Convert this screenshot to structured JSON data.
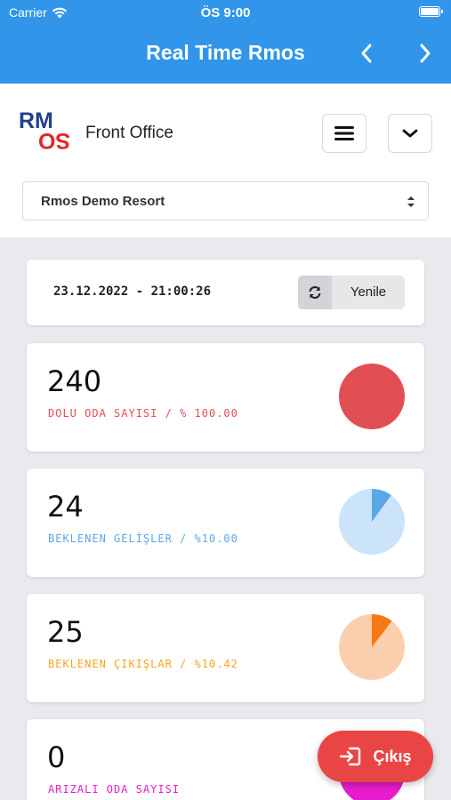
{
  "status_bar": {
    "carrier": "Carrier",
    "time": "ÖS 9:00",
    "wifi_icon": "wifi-icon",
    "battery_icon": "battery-icon"
  },
  "nav": {
    "title": "Real Time Rmos",
    "prev_icon": "chevron-left-icon",
    "next_icon": "chevron-right-icon"
  },
  "header": {
    "logo": "RMOS",
    "app_name": "Front Office",
    "menu_icon": "hamburger-menu-icon",
    "collapse_icon": "chevron-down-icon",
    "hotel_select": {
      "value": "Rmos Demo Resort"
    }
  },
  "date_card": {
    "datetime": "23.12.2022 - 21:00:26",
    "refresh_label": "Yenile",
    "refresh_icon": "refresh-icon"
  },
  "stats": [
    {
      "value": "240",
      "label": "DOLU ODA SAYISI / % 100.00",
      "color": "#e14f52",
      "pie_bg": "#e14f52",
      "fraction": 1.0
    },
    {
      "value": "24",
      "label": "BEKLENEN GELİŞLER / %10.00",
      "color": "#5aa7e6",
      "pie_bg": "#cbe4f9",
      "fraction": 0.1
    },
    {
      "value": "25",
      "label": "BEKLENEN ÇIKIŞLAR / %10.42",
      "color": "#f4a51c",
      "pie_bg": "#fbcfad",
      "slice_color": "#f57a14",
      "fraction": 0.1042
    },
    {
      "value": "0",
      "label": "ARIZALI ODA SAYISI",
      "color": "#e81ccf",
      "pie_bg": "#e81ccf",
      "fraction": 0
    }
  ],
  "exit_button": {
    "label": "Çıkış",
    "icon": "sign-in-icon",
    "color": "#ea4545"
  }
}
